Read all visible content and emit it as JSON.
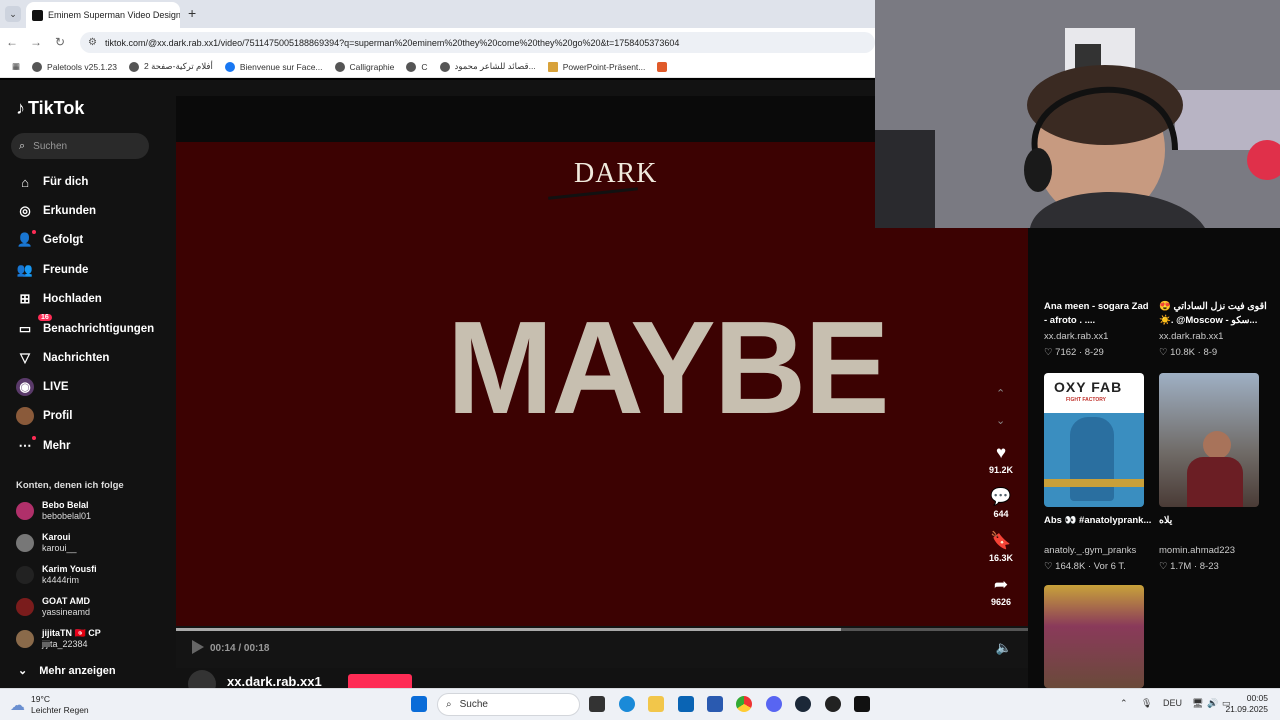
{
  "browser": {
    "tab_title": "Eminem Superman Video Design",
    "url": "tiktok.com/@xx.dark.rab.xx1/video/7511475005188869394?q=superman%20eminem%20they%20come%20they%20go%20&t=1758405373604",
    "bookmarks": [
      "Paletools v25.1.23",
      "أفلام تركية-صفحة 2",
      "Bienvenue sur Face...",
      "Calligraphie",
      "C",
      "قصائد للشاعر محمود...",
      "PowerPoint-Präsent..."
    ]
  },
  "sidebar": {
    "logo": "TikTok",
    "search_placeholder": "Suchen",
    "nav": [
      {
        "label": "Für dich",
        "icon": "home-icon"
      },
      {
        "label": "Erkunden",
        "icon": "compass-icon"
      },
      {
        "label": "Gefolgt",
        "icon": "following-icon"
      },
      {
        "label": "Freunde",
        "icon": "friends-icon"
      },
      {
        "label": "Hochladen",
        "icon": "upload-icon"
      },
      {
        "label": "Benachrichtigungen",
        "icon": "inbox-icon",
        "badge": "16"
      },
      {
        "label": "Nachrichten",
        "icon": "messages-icon"
      },
      {
        "label": "LIVE",
        "icon": "live-icon"
      },
      {
        "label": "Profil",
        "icon": "profile-icon"
      },
      {
        "label": "Mehr",
        "icon": "more-icon"
      }
    ],
    "following_header": "Konten, denen ich folge",
    "accounts": [
      {
        "name": "Bebo Belal",
        "handle": "bebobelal01",
        "color": "#b0306a"
      },
      {
        "name": "Karoui",
        "handle": "karoui__",
        "color": "#777"
      },
      {
        "name": "Karim Yousfi",
        "handle": "k4444rim",
        "color": "#222"
      },
      {
        "name": "GOAT AMD",
        "handle": "yassineamd",
        "color": "#7a1c1c"
      },
      {
        "name": "jijitaTN 🇹🇳 CP",
        "handle": "jijita_22384",
        "color": "#8a6a4a"
      }
    ],
    "show_more": "Mehr anzeigen"
  },
  "video": {
    "logo_text": "DARK",
    "main_text": "MAYBE",
    "time": "00:14 / 00:18",
    "progress": 0.78,
    "username": "xx.dark.rab.xx1",
    "actions": [
      {
        "icon": "heart-icon",
        "count": "91.2K"
      },
      {
        "icon": "comment-icon",
        "count": "644"
      },
      {
        "icon": "bookmark-icon",
        "count": "16.3K"
      },
      {
        "icon": "share-icon",
        "count": "9626"
      }
    ]
  },
  "related": [
    {
      "title": "Ana meen - sogara Zad - afroto . ....",
      "author": "xx.dark.rab.xx1",
      "likes": "7162",
      "date": "8-29",
      "thumb": ""
    },
    {
      "title": "😍 اقوى فيت نزل الساداتي ☀️. @Moscow - سكو...",
      "author": "xx.dark.rab.xx1",
      "likes": "10.8K",
      "date": "8-9",
      "thumb": ""
    },
    {
      "title": "Abs 👀 #anatolyprank...",
      "author": "anatoly._.gym_pranks",
      "likes": "164.8K",
      "date": "Vor 6 T.",
      "thumb": "OXY FAB",
      "thumb_sub": "FIGHT FACTORY"
    },
    {
      "title": "يلاه",
      "author": "momin.ahmad223",
      "likes": "1.7M",
      "date": "8-23",
      "thumb": ""
    }
  ],
  "taskbar": {
    "temperature": "19°C",
    "weather": "Leichter Regen",
    "search": "Suche",
    "language": "DEU",
    "time": "00:05",
    "date": "21.09.2025"
  },
  "colors": {
    "accent": "#fe2c55",
    "video_bg": "#3c0202",
    "sidebar_bg": "#121212"
  }
}
